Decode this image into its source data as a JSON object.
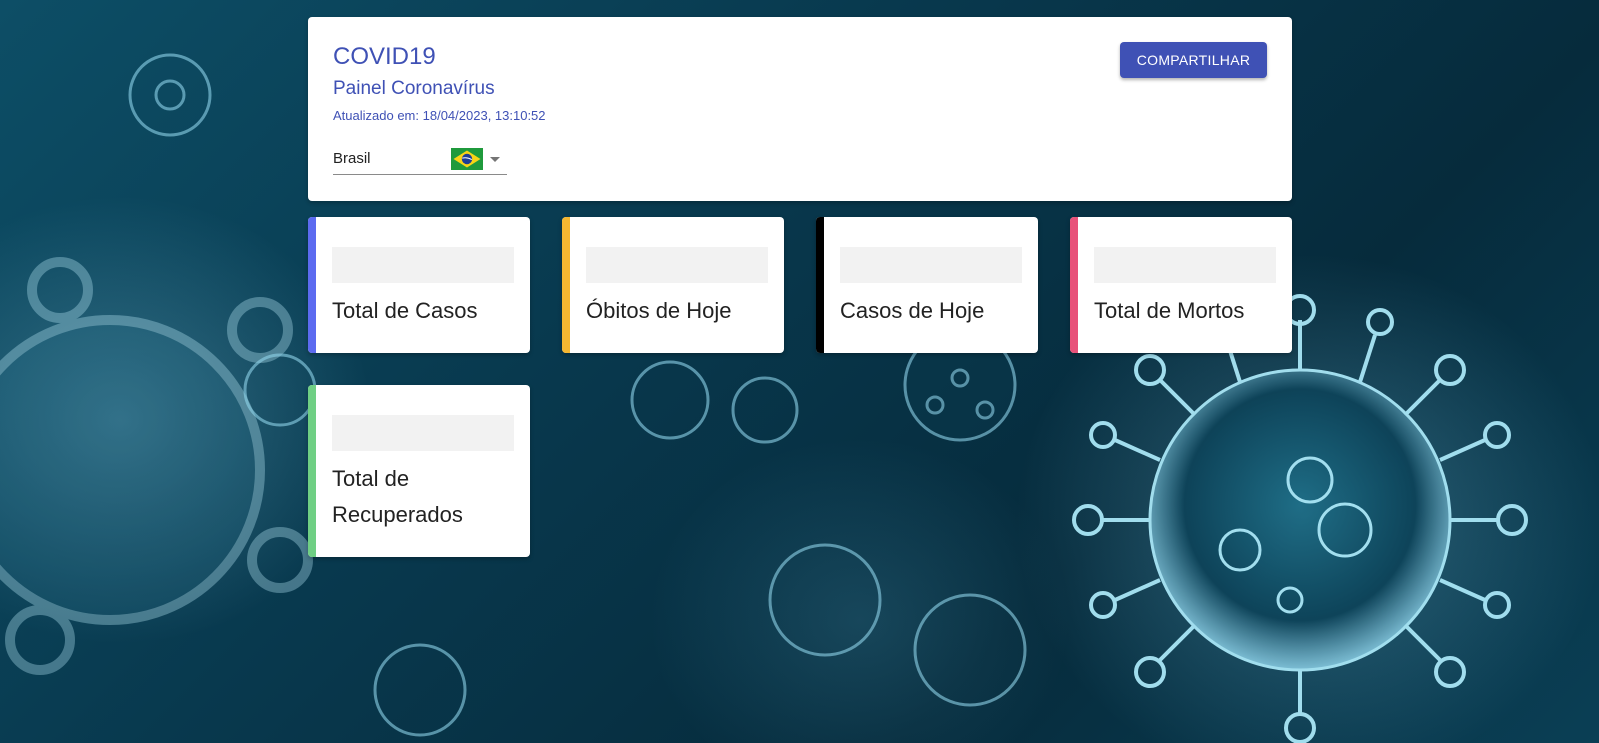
{
  "header": {
    "title": "COVID19",
    "subtitle": "Painel Coronavírus",
    "updated_label": "Atualizado em:",
    "updated_value": "18/04/2023, 13:10:52",
    "share_label": "COMPARTILHAR"
  },
  "country_select": {
    "selected": "Brasil",
    "flag_icon": "brazil-flag-icon"
  },
  "stats": [
    {
      "label": "Total de Casos",
      "accent": "#5c6bf0"
    },
    {
      "label": "Óbitos de Hoje",
      "accent": "#f5b731"
    },
    {
      "label": "Casos de Hoje",
      "accent": "#000000"
    },
    {
      "label": "Total de Mortos",
      "accent": "#e8527a"
    },
    {
      "label": "Total de Recuperados",
      "accent": "#6fcf84"
    }
  ],
  "colors": {
    "primary": "#3f51b5",
    "background": "#08384d"
  }
}
